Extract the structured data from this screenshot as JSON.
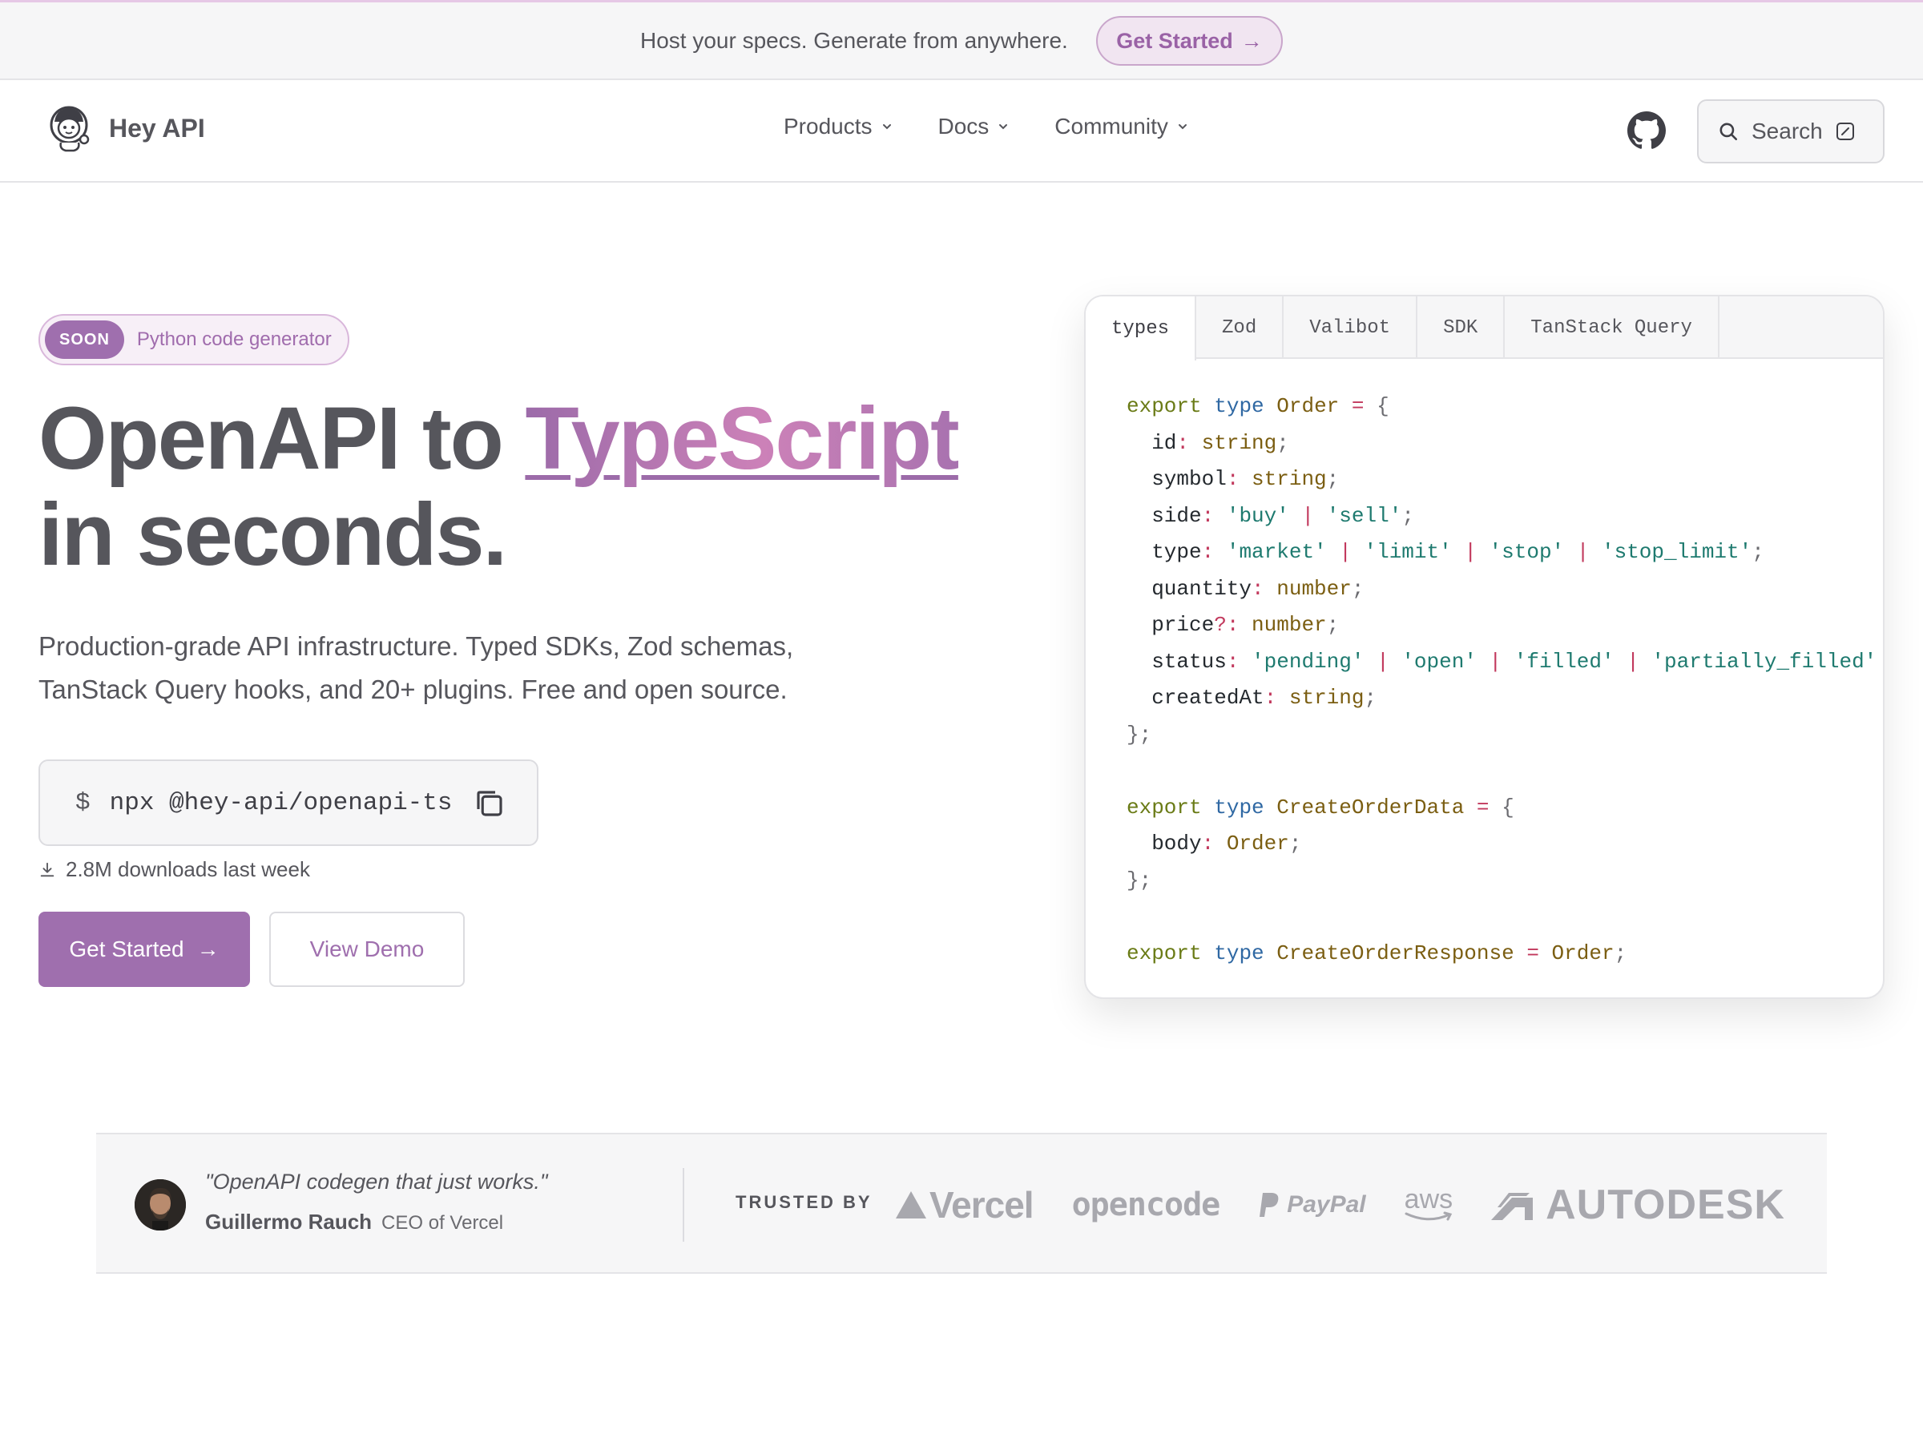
{
  "banner": {
    "text": "Host your specs. Generate from anywhere.",
    "cta_label": "Get Started",
    "cta_arrow": "→"
  },
  "nav": {
    "brand": "Hey API",
    "items": [
      {
        "label": "Products"
      },
      {
        "label": "Docs"
      },
      {
        "label": "Community"
      }
    ],
    "search_label": "Search"
  },
  "hero": {
    "badge": "SOON",
    "badge_text": "Python code generator",
    "title_part1": "OpenAPI to ",
    "title_highlight": "TypeScript",
    "title_part2": "in seconds.",
    "subtitle_line1": "Production-grade API infrastructure. Typed SDKs, Zod schemas,",
    "subtitle_line2": "TanStack Query hooks, and 20+ plugins. Free and open source.",
    "install_prompt": "$",
    "install_command": "npx @hey-api/openapi-ts",
    "downloads": "2.8M downloads last week",
    "primary_cta": "Get Started",
    "primary_cta_arrow": "→",
    "secondary_cta": "View Demo "
  },
  "code_card": {
    "tabs": [
      "types",
      "Zod",
      "Valibot",
      "SDK",
      "TanStack Query"
    ],
    "active_tab": "types",
    "lines": [
      [
        [
          "kw",
          "export"
        ],
        [
          "pu",
          " "
        ],
        [
          "ty",
          "type"
        ],
        [
          "pu",
          " "
        ],
        [
          "nm",
          "Order"
        ],
        [
          "pu",
          " "
        ],
        [
          "op",
          "="
        ],
        [
          "pu",
          " {"
        ]
      ],
      [
        [
          "pr",
          "  id"
        ],
        [
          "op",
          ":"
        ],
        [
          "pu",
          " "
        ],
        [
          "nm",
          "string"
        ],
        [
          "pu",
          ";"
        ]
      ],
      [
        [
          "pr",
          "  symbol"
        ],
        [
          "op",
          ":"
        ],
        [
          "pu",
          " "
        ],
        [
          "nm",
          "string"
        ],
        [
          "pu",
          ";"
        ]
      ],
      [
        [
          "pr",
          "  side"
        ],
        [
          "op",
          ":"
        ],
        [
          "pu",
          " "
        ],
        [
          "st",
          "'buy'"
        ],
        [
          "pu",
          " "
        ],
        [
          "op",
          "|"
        ],
        [
          "pu",
          " "
        ],
        [
          "st",
          "'sell'"
        ],
        [
          "pu",
          ";"
        ]
      ],
      [
        [
          "pr",
          "  type"
        ],
        [
          "op",
          ":"
        ],
        [
          "pu",
          " "
        ],
        [
          "st",
          "'market'"
        ],
        [
          "pu",
          " "
        ],
        [
          "op",
          "|"
        ],
        [
          "pu",
          " "
        ],
        [
          "st",
          "'limit'"
        ],
        [
          "pu",
          " "
        ],
        [
          "op",
          "|"
        ],
        [
          "pu",
          " "
        ],
        [
          "st",
          "'stop'"
        ],
        [
          "pu",
          " "
        ],
        [
          "op",
          "|"
        ],
        [
          "pu",
          " "
        ],
        [
          "st",
          "'stop_limit'"
        ],
        [
          "pu",
          ";"
        ]
      ],
      [
        [
          "pr",
          "  quantity"
        ],
        [
          "op",
          ":"
        ],
        [
          "pu",
          " "
        ],
        [
          "nm",
          "number"
        ],
        [
          "pu",
          ";"
        ]
      ],
      [
        [
          "pr",
          "  price"
        ],
        [
          "op",
          "?:"
        ],
        [
          "pu",
          " "
        ],
        [
          "nm",
          "number"
        ],
        [
          "pu",
          ";"
        ]
      ],
      [
        [
          "pr",
          "  status"
        ],
        [
          "op",
          ":"
        ],
        [
          "pu",
          " "
        ],
        [
          "st",
          "'pending'"
        ],
        [
          "pu",
          " "
        ],
        [
          "op",
          "|"
        ],
        [
          "pu",
          " "
        ],
        [
          "st",
          "'open'"
        ],
        [
          "pu",
          " "
        ],
        [
          "op",
          "|"
        ],
        [
          "pu",
          " "
        ],
        [
          "st",
          "'filled'"
        ],
        [
          "pu",
          " "
        ],
        [
          "op",
          "|"
        ],
        [
          "pu",
          " "
        ],
        [
          "st",
          "'partially_filled'"
        ]
      ],
      [
        [
          "pr",
          "  createdAt"
        ],
        [
          "op",
          ":"
        ],
        [
          "pu",
          " "
        ],
        [
          "nm",
          "string"
        ],
        [
          "pu",
          ";"
        ]
      ],
      [
        [
          "pu",
          "};"
        ]
      ],
      [
        [
          "pu",
          " "
        ]
      ],
      [
        [
          "kw",
          "export"
        ],
        [
          "pu",
          " "
        ],
        [
          "ty",
          "type"
        ],
        [
          "pu",
          " "
        ],
        [
          "nm",
          "CreateOrderData"
        ],
        [
          "pu",
          " "
        ],
        [
          "op",
          "="
        ],
        [
          "pu",
          " {"
        ]
      ],
      [
        [
          "pr",
          "  body"
        ],
        [
          "op",
          ":"
        ],
        [
          "pu",
          " "
        ],
        [
          "nm",
          "Order"
        ],
        [
          "pu",
          ";"
        ]
      ],
      [
        [
          "pu",
          "};"
        ]
      ],
      [
        [
          "pu",
          " "
        ]
      ],
      [
        [
          "kw",
          "export"
        ],
        [
          "pu",
          " "
        ],
        [
          "ty",
          "type"
        ],
        [
          "pu",
          " "
        ],
        [
          "nm",
          "CreateOrderResponse"
        ],
        [
          "pu",
          " "
        ],
        [
          "op",
          "="
        ],
        [
          "pu",
          " "
        ],
        [
          "nm",
          "Order"
        ],
        [
          "pu",
          ";"
        ]
      ]
    ]
  },
  "testimonial": {
    "quote": "\"OpenAPI codegen that just works.\"",
    "name": "Guillermo Rauch",
    "role": "CEO of Vercel",
    "trusted_label": "TRUSTED BY",
    "logos": [
      "Vercel",
      "opencode",
      "PayPal",
      "aws",
      "AUTODESK"
    ]
  },
  "colors": {
    "accent": "#9f6fae",
    "text": "#56565c",
    "border": "#e4e4e7",
    "surface": "#f6f6f7"
  },
  "icons": {
    "brand_logo": "astronaut-mascot-icon",
    "nav_chevron": "chevron-down-icon",
    "github": "github-icon",
    "search": "search-icon",
    "search_shortcut": "slash-key-icon",
    "copy": "copy-icon",
    "download": "download-icon"
  }
}
